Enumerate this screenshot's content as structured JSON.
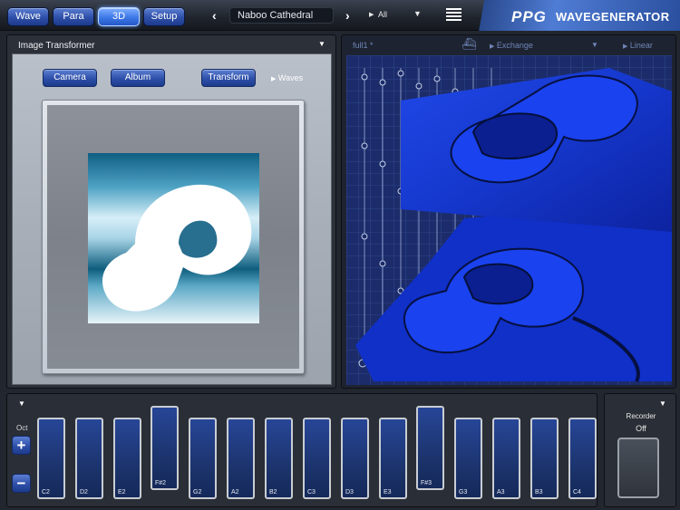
{
  "tabs": [
    {
      "label": "Wave"
    },
    {
      "label": "Para"
    },
    {
      "label": "3D",
      "active": true
    },
    {
      "label": "Setup"
    }
  ],
  "preset": {
    "name": "Naboo Cathedral",
    "prev_icon": "chevron-left-icon",
    "next_icon": "chevron-right-icon"
  },
  "bank_filter": {
    "label": "All",
    "play_icon": "play-small-icon",
    "dropdown_icon": "triangle-down-icon"
  },
  "menu_icon": "hamburger-menu-icon",
  "brand": {
    "logo": "PPG",
    "name": "WAVEGENERATOR"
  },
  "image_transformer": {
    "title": "Image Transformer",
    "buttons": {
      "camera": "Camera",
      "album": "Album",
      "transform": "Transform"
    },
    "waves_label": "Waves",
    "image": "ppg-logo-image"
  },
  "graph_header": {
    "wave_name": "full1 *",
    "exchange": "Exchange",
    "mode": "Linear",
    "ship_icon": "ship-icon"
  },
  "octave": {
    "label": "Oct",
    "plus": "+",
    "minus": "−"
  },
  "keys": [
    {
      "label": "C2",
      "type": "white"
    },
    {
      "label": "D2",
      "type": "white"
    },
    {
      "label": "E2",
      "type": "white"
    },
    {
      "label": "F#2",
      "type": "black"
    },
    {
      "label": "G2",
      "type": "white"
    },
    {
      "label": "A2",
      "type": "white"
    },
    {
      "label": "B2",
      "type": "white"
    },
    {
      "label": "C3",
      "type": "white"
    },
    {
      "label": "D3",
      "type": "white"
    },
    {
      "label": "E3",
      "type": "white"
    },
    {
      "label": "F#3",
      "type": "black"
    },
    {
      "label": "G3",
      "type": "white"
    },
    {
      "label": "A3",
      "type": "white"
    },
    {
      "label": "B3",
      "type": "white"
    },
    {
      "label": "C4",
      "type": "white"
    }
  ],
  "recorder": {
    "label": "Recorder",
    "state": "Off"
  },
  "colors": {
    "accent_blue": "#3d78e6",
    "wave_blue": "#1a3fd9",
    "panel_dark": "#2c3038"
  }
}
